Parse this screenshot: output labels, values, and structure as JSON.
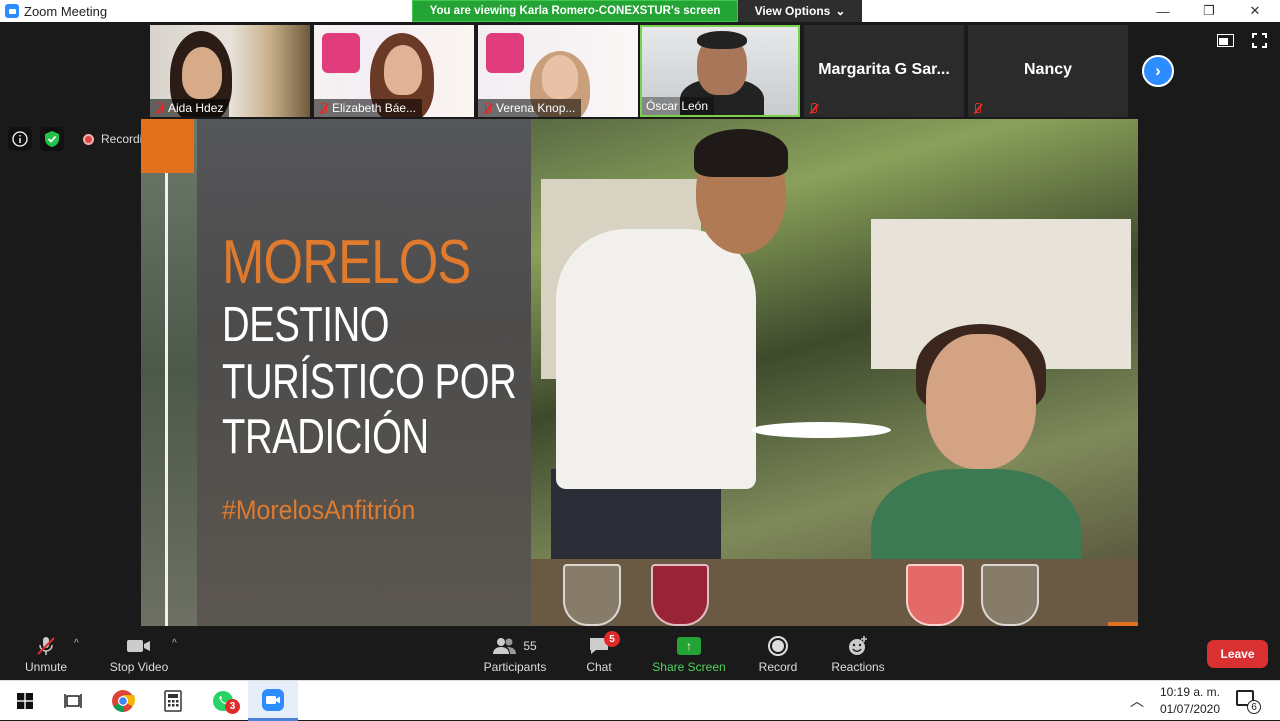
{
  "window": {
    "title": "Zoom Meeting",
    "minimize": "—",
    "maximize": "❐",
    "close": "✕"
  },
  "banner": {
    "text": "You are viewing Karla Romero-CONEXSTUR's screen",
    "view_options": "View Options"
  },
  "participants_strip": [
    {
      "name": "Aida Hdez",
      "muted": true
    },
    {
      "name": "Elizabeth Báe...",
      "muted": true
    },
    {
      "name": "Verena Knop...",
      "muted": true
    },
    {
      "name": "Óscar León",
      "muted": false,
      "active": true
    },
    {
      "name": "Margarita G Sar...",
      "muted": true
    },
    {
      "name": "Nancy",
      "muted": true
    }
  ],
  "status": {
    "recording_label": "Recording"
  },
  "slide": {
    "title": "MORELOS",
    "line1": "DESTINO",
    "line2": "TURÍSTICO POR",
    "line3": "TRADICIÓN",
    "hashtag": "#MorelosAnfitrión",
    "accent_color": "#e07a2c"
  },
  "toolbar": {
    "unmute": "Unmute",
    "stop_video": "Stop Video",
    "participants": "Participants",
    "participants_count": "55",
    "chat": "Chat",
    "chat_badge": "5",
    "share_screen": "Share Screen",
    "record": "Record",
    "reactions": "Reactions",
    "leave": "Leave"
  },
  "taskbar": {
    "whatsapp_badge": "3",
    "time": "10:19 a. m.",
    "date": "01/07/2020",
    "notifications": "6"
  }
}
